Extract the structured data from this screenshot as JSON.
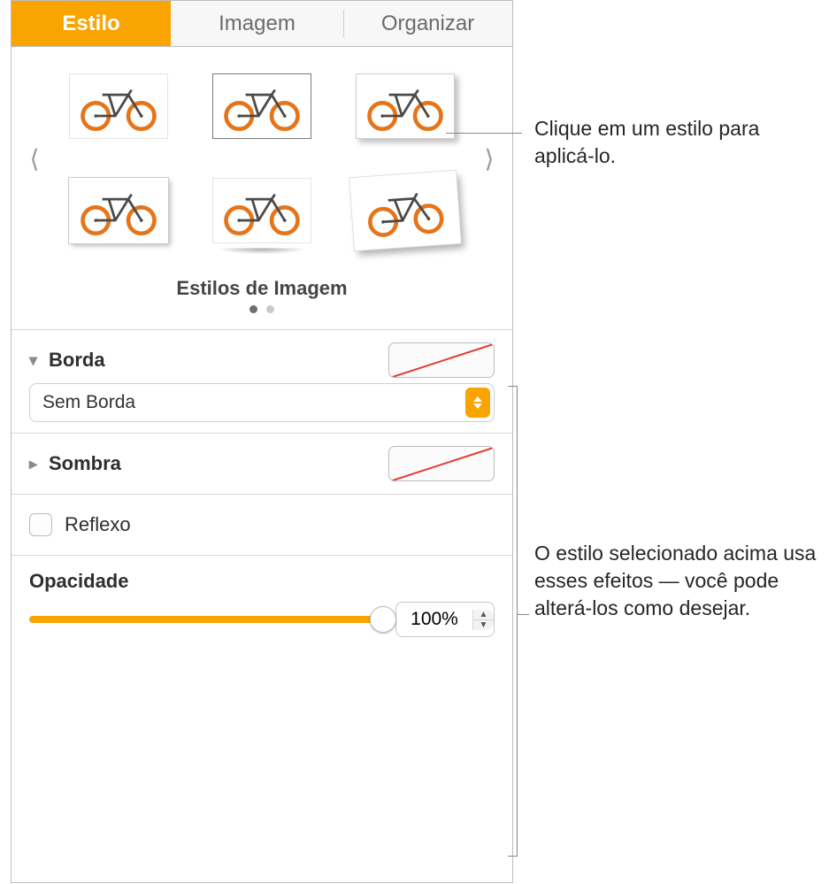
{
  "tabs": {
    "estilo": "Estilo",
    "imagem": "Imagem",
    "organizar": "Organizar"
  },
  "styles": {
    "title": "Estilos de Imagem"
  },
  "borda": {
    "label": "Borda",
    "select_value": "Sem Borda"
  },
  "sombra": {
    "label": "Sombra"
  },
  "reflexo": {
    "label": "Reflexo"
  },
  "opacidade": {
    "label": "Opacidade",
    "value": "100%",
    "slider_percent": 100
  },
  "callouts": {
    "styles": "Clique em um estilo para aplicá-lo.",
    "effects": "O estilo selecionado acima usa esses efeitos — você pode alterá-los como desejar."
  }
}
